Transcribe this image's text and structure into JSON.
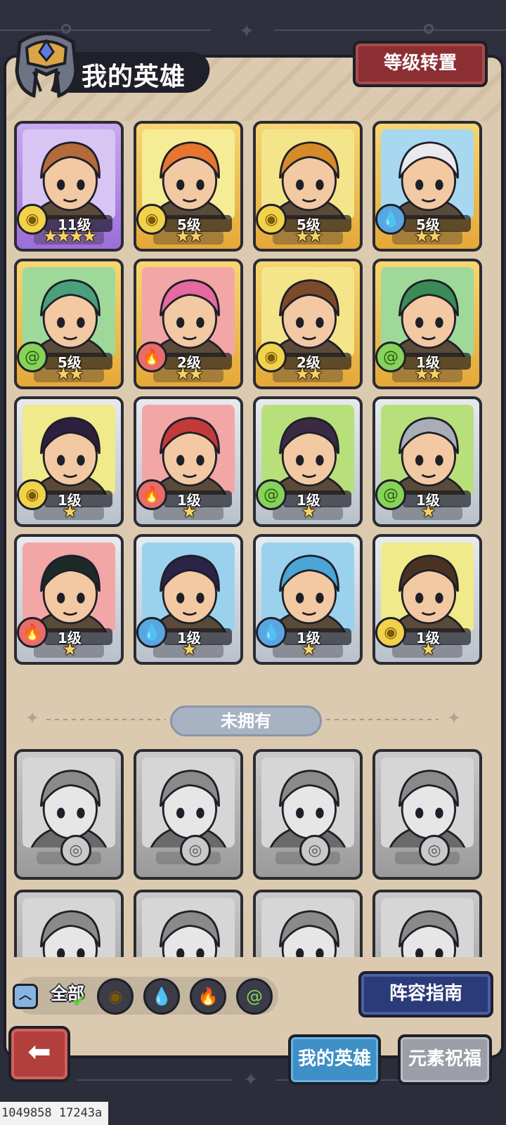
{
  "header": {
    "title": "我的英雄",
    "level_reset_label": "等级转置"
  },
  "owned_heroes": [
    {
      "level": "11级",
      "stars": "★★★★",
      "element": "earth",
      "frame": "purple",
      "badge": true,
      "portrait": "tiger-warrior"
    },
    {
      "level": "5级",
      "stars": "★★",
      "element": "earth",
      "frame": "gold",
      "badge": true,
      "portrait": "orange-haired-girl"
    },
    {
      "level": "5级",
      "stars": "★★",
      "element": "earth",
      "frame": "gold",
      "badge": true,
      "portrait": "bearded-dwarf"
    },
    {
      "level": "5级",
      "stars": "★★",
      "element": "water",
      "frame": "gold",
      "badge": true,
      "portrait": "white-haired-goggles-girl"
    },
    {
      "level": "5级",
      "stars": "★★",
      "element": "wind",
      "frame": "gold",
      "badge": false,
      "portrait": "green-haired-elf"
    },
    {
      "level": "2级",
      "stars": "★★",
      "element": "fire",
      "frame": "gold",
      "badge": false,
      "portrait": "pink-haired-engineer"
    },
    {
      "level": "2级",
      "stars": "★★",
      "element": "earth",
      "frame": "gold",
      "badge": false,
      "portrait": "dreadlock-fighter"
    },
    {
      "level": "1级",
      "stars": "★★",
      "element": "wind",
      "frame": "gold",
      "badge": false,
      "portrait": "green-haired-ranger"
    },
    {
      "level": "1级",
      "stars": "★",
      "element": "earth",
      "frame": "silver",
      "badge": false,
      "portrait": "dark-haired-assassin"
    },
    {
      "level": "1级",
      "stars": "★",
      "element": "fire",
      "frame": "silver",
      "badge": false,
      "portrait": "red-haired-elf"
    },
    {
      "level": "1级",
      "stars": "★",
      "element": "wind",
      "frame": "silver",
      "badge": false,
      "portrait": "horned-shaman"
    },
    {
      "level": "1级",
      "stars": "★",
      "element": "wind",
      "frame": "silver",
      "badge": false,
      "portrait": "armored-knight"
    },
    {
      "level": "1级",
      "stars": "★",
      "element": "fire",
      "frame": "silver",
      "badge": false,
      "portrait": "black-haired-swordsman"
    },
    {
      "level": "1级",
      "stars": "★",
      "element": "water",
      "frame": "silver",
      "badge": false,
      "portrait": "purple-haired-mage"
    },
    {
      "level": "1级",
      "stars": "★",
      "element": "water",
      "frame": "silver",
      "badge": false,
      "portrait": "blue-dragon"
    },
    {
      "level": "1级",
      "stars": "★",
      "element": "earth",
      "frame": "silver",
      "badge": false,
      "portrait": "bearded-rogue"
    }
  ],
  "unowned": {
    "label": "未拥有",
    "heroes": [
      "shark-warrior",
      "crowned-queen",
      "gear-scholar",
      "elf-priestess",
      "elf-girl",
      "elf-noble",
      "horned-beast",
      "jeweled-king"
    ]
  },
  "filters": {
    "all_label": "全部",
    "elements": [
      "earth",
      "water",
      "fire",
      "wind"
    ]
  },
  "buttons": {
    "lineup_guide": "阵容指南",
    "back": "back-arrow"
  },
  "tabs": [
    {
      "label": "我的英雄",
      "active": true
    },
    {
      "label": "元素祝福",
      "active": false
    }
  ],
  "debug_text": "1049858 17243a",
  "colors": {
    "panel": "#dccab0",
    "gold_frame": "#f6d673",
    "purple_frame": "#c8a9ef",
    "silver_frame": "#e6eaef",
    "red_button": "#8c2f33",
    "blue_button": "#2b3b79",
    "tab_active": "#3d8fc6"
  }
}
